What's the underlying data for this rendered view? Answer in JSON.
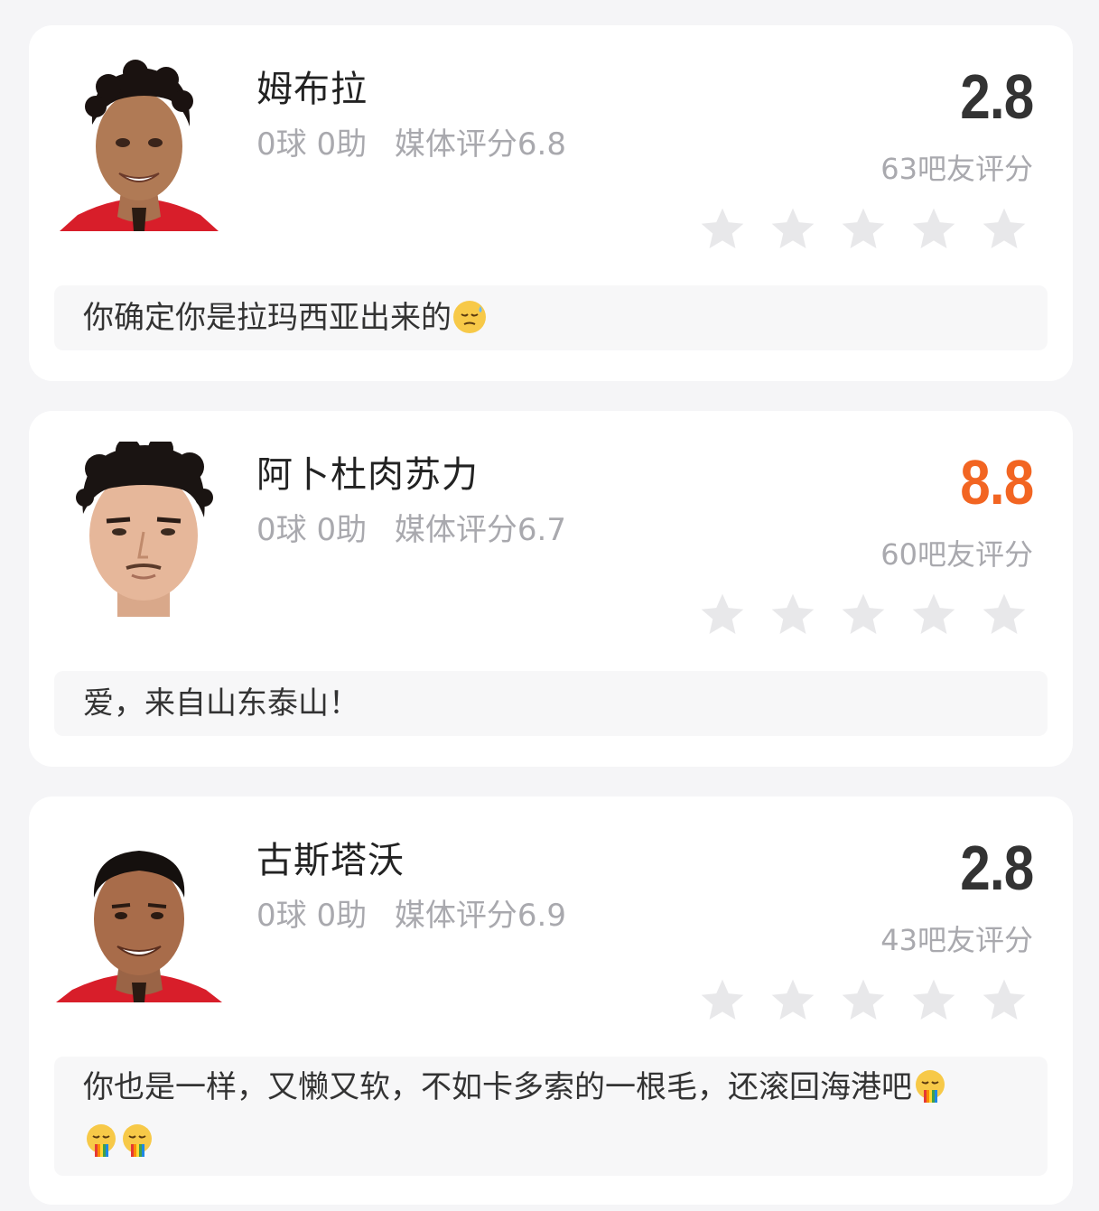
{
  "players": [
    {
      "name": "姆布拉",
      "goals": "0球",
      "assists": "0助",
      "media_rating": "媒体评分6.8",
      "fan_score": "2.8",
      "fan_count": "63吧友评分",
      "comment": "你确定你是拉玛西亚出来的",
      "comment_emoji": "weary-sweat-emoji"
    },
    {
      "name": "阿卜杜肉苏力",
      "goals": "0球",
      "assists": "0助",
      "media_rating": "媒体评分6.7",
      "fan_score": "8.8",
      "fan_count": "60吧友评分",
      "comment": "爱，来自山东泰山！",
      "comment_emoji": ""
    },
    {
      "name": "古斯塔沃",
      "goals": "0球",
      "assists": "0助",
      "media_rating": "媒体评分6.9",
      "fan_score": "2.8",
      "fan_count": "43吧友评分",
      "comment": "你也是一样，又懒又软，不如卡多索的一根毛，还滚回海港吧",
      "comment_emoji": "rainbow-vomit-emoji"
    }
  ],
  "colors": {
    "background": "#f5f5f7",
    "card": "#ffffff",
    "score_normal": "#333333",
    "score_high": "#f26522",
    "muted_text": "#a9a9ae",
    "star_empty": "#e8e8ea"
  }
}
